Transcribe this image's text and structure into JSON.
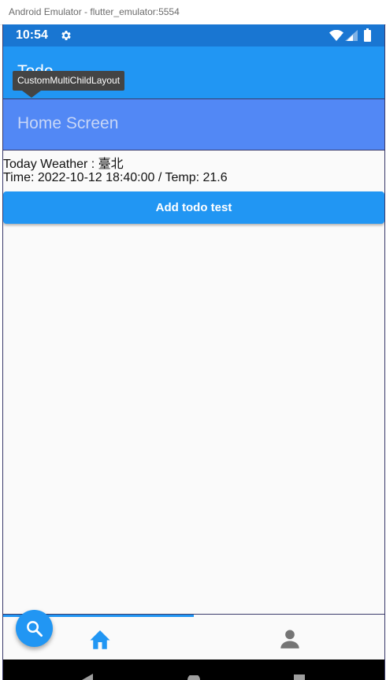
{
  "window": {
    "title": "Android Emulator - flutter_emulator:5554"
  },
  "statusbar": {
    "time": "10:54"
  },
  "appbar": {
    "title": "Todo"
  },
  "tooltip": {
    "text": "CustomMultiChildLayout"
  },
  "home": {
    "title": "Home Screen"
  },
  "weather": {
    "city_line": "Today Weather : 臺北",
    "time_line": "Time: 2022-10-12 18:40:00 / Temp: 21.6"
  },
  "actions": {
    "add_todo_label": "Add todo test"
  },
  "bottom_nav": {
    "items": [
      {
        "icon": "home-icon",
        "active": true
      },
      {
        "icon": "person-icon",
        "active": false
      }
    ]
  },
  "fab": {
    "icon": "search-icon"
  },
  "colors": {
    "primary": "#2196f3",
    "statusbar": "#1976d2",
    "home_header": "#5288f5",
    "home_header_text": "#c7d6f7",
    "inactive_icon": "#757575"
  }
}
